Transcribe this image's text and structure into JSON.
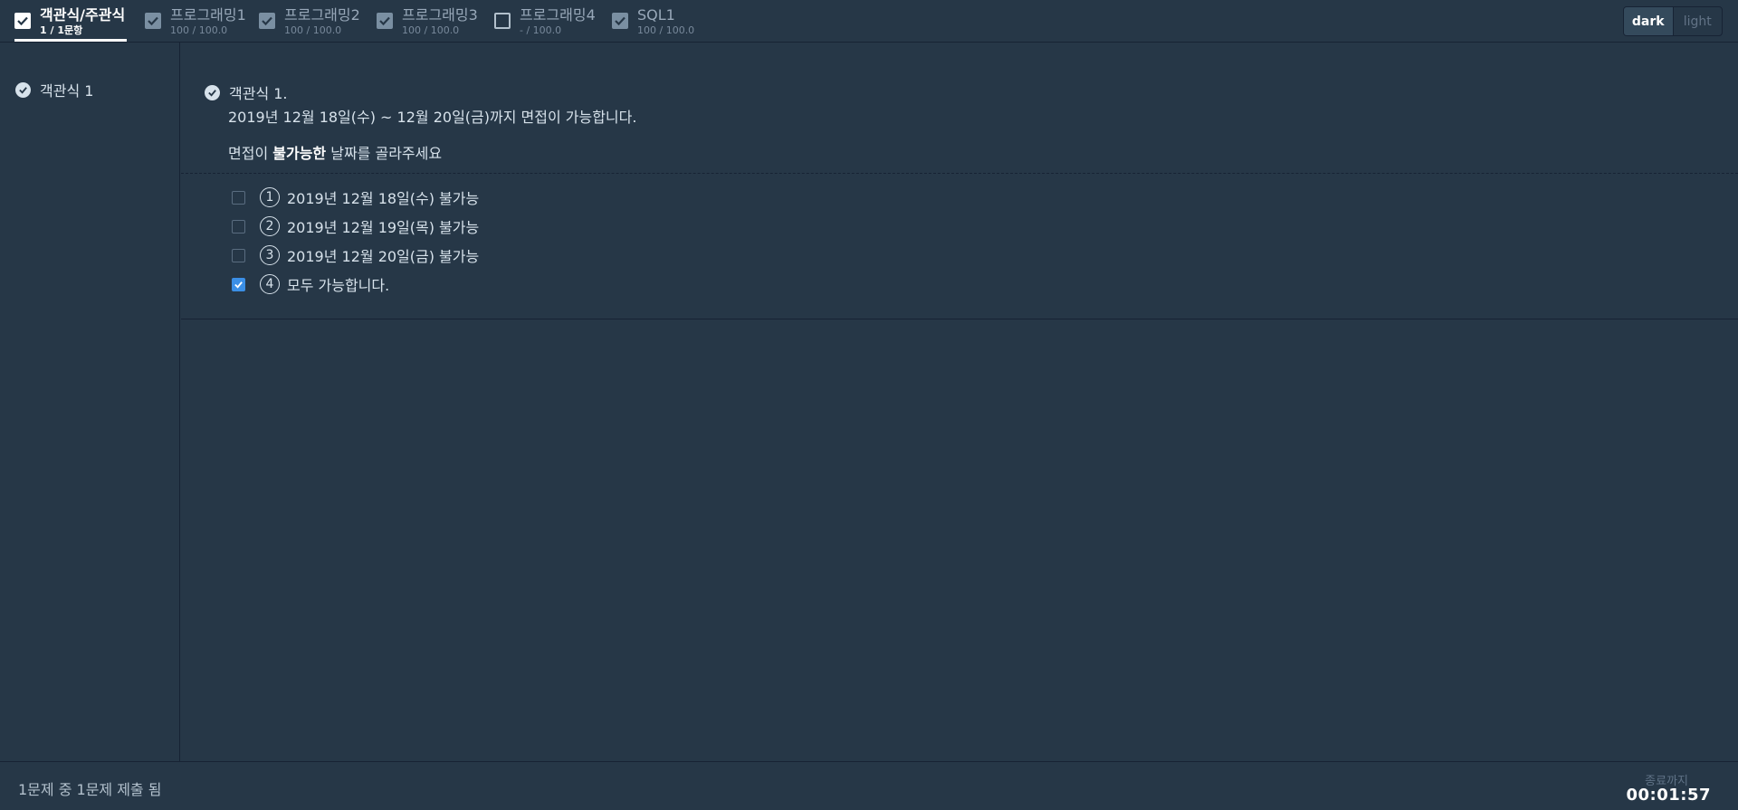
{
  "header": {
    "tabs": [
      {
        "name": "객관식/주관식",
        "score": "1 / 1문항",
        "checked": true,
        "active": true
      },
      {
        "name": "프로그래밍1",
        "score": "100 / 100.0",
        "checked": true,
        "active": false
      },
      {
        "name": "프로그래밍2",
        "score": "100 / 100.0",
        "checked": true,
        "active": false
      },
      {
        "name": "프로그래밍3",
        "score": "100 / 100.0",
        "checked": true,
        "active": false
      },
      {
        "name": "프로그래밍4",
        "score": "- / 100.0",
        "checked": false,
        "active": false
      },
      {
        "name": "SQL1",
        "score": "100 / 100.0",
        "checked": true,
        "active": false
      }
    ],
    "theme": {
      "dark": "dark",
      "light": "light",
      "selected": "dark"
    }
  },
  "sidebar": {
    "items": [
      {
        "label": "객관식 1",
        "icon": "check-circle-icon"
      }
    ]
  },
  "question": {
    "title": "객관식 1.",
    "text": "2019년 12월 18일(수) ~ 12월 20일(금)까지 면접이 가능합니다.",
    "sub_prefix": "면접이 ",
    "sub_bold": "불가능한",
    "sub_suffix": " 날짜를 골라주세요",
    "options": [
      {
        "num": "1",
        "label": "2019년 12월 18일(수) 불가능",
        "checked": false
      },
      {
        "num": "2",
        "label": "2019년 12월 19일(목) 불가능",
        "checked": false
      },
      {
        "num": "3",
        "label": "2019년 12월 20일(금) 불가능",
        "checked": false
      },
      {
        "num": "4",
        "label": "모두 가능합니다.",
        "checked": true
      }
    ]
  },
  "footer": {
    "status": "1문제 중 1문제 제출 됨",
    "timer_label": "종료까지",
    "timer": "00:01:57"
  },
  "colors": {
    "background": "#263747",
    "border": "#172334",
    "text": "#d7e2eb",
    "checkbox_checked": "#3b8fe6"
  }
}
